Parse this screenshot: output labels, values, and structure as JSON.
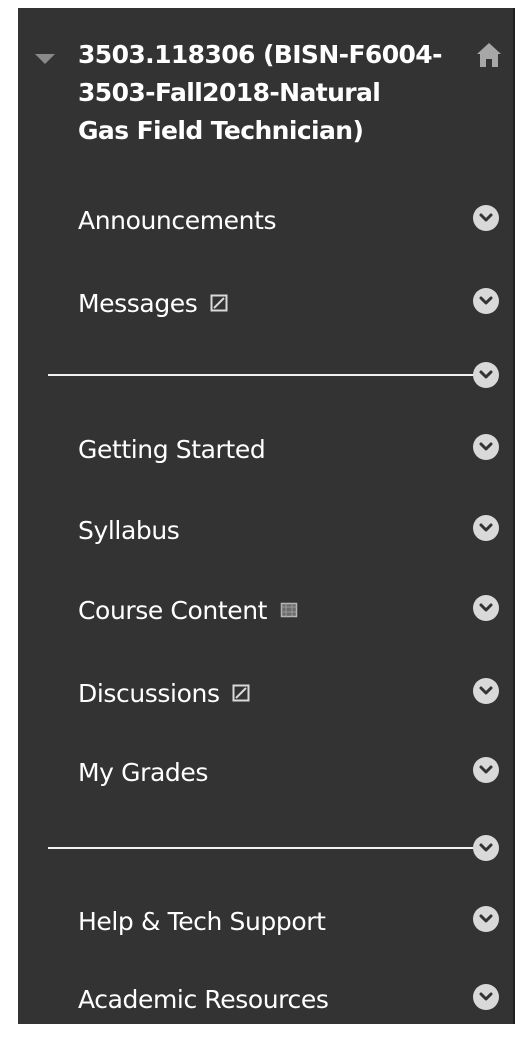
{
  "course": {
    "title": "3503.118306 (BISN-F6004-\n3503-Fall2018-Natural\nGas Field Technician)",
    "collapse_icon": "triangle-down-icon",
    "home_icon": "home-icon"
  },
  "menu": {
    "items": [
      {
        "label": "Announcements"
      },
      {
        "label": "Messages",
        "inline_icon": "slash-box-icon"
      },
      {
        "label": "Getting Started"
      },
      {
        "label": "Syllabus"
      },
      {
        "label": "Course Content",
        "inline_icon": "grid-box-icon"
      },
      {
        "label": "Discussions",
        "inline_icon": "slash-box-icon"
      },
      {
        "label": "My Grades"
      },
      {
        "label": "Help & Tech Support"
      },
      {
        "label": "Academic Resources"
      }
    ],
    "item_action_icon": "chevron-down-circle-icon",
    "divider_action_icon": "chevron-down-circle-icon"
  },
  "colors": {
    "panel_bg": "#333333",
    "text": "#ffffff",
    "chevron_bg": "#d9d9d9",
    "chevron_fg": "#333333",
    "divider": "#f2f2f2"
  }
}
